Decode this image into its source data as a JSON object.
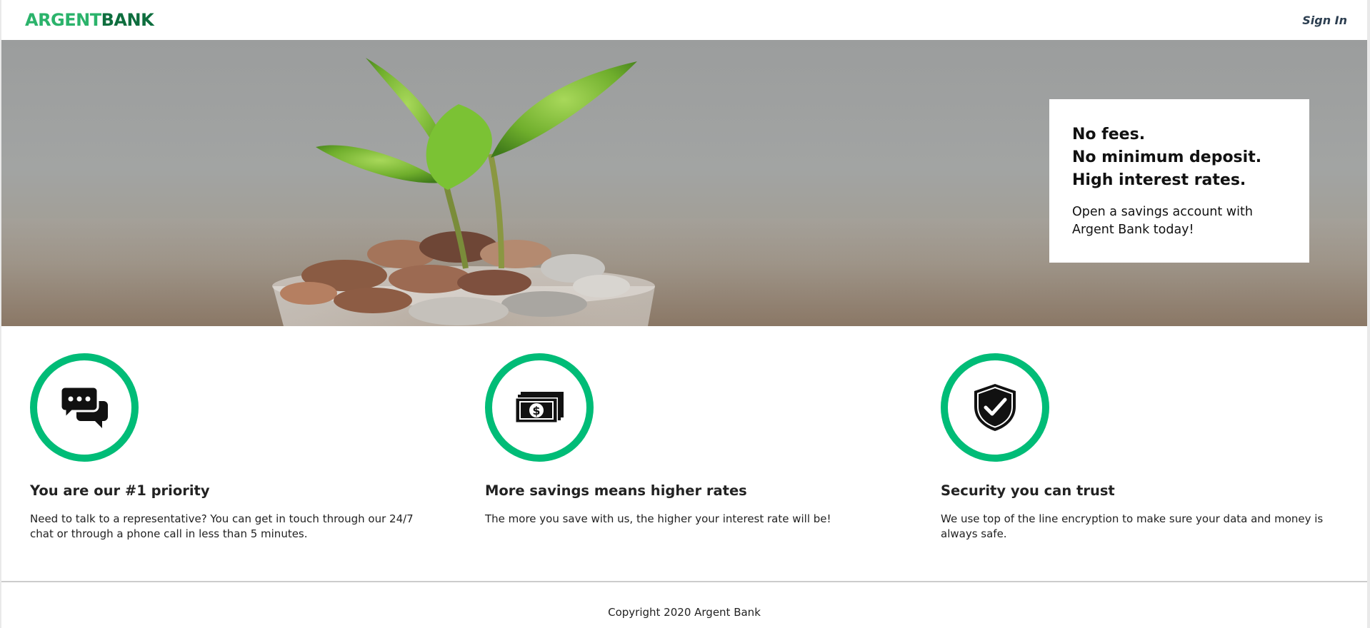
{
  "nav": {
    "logo_part1": "ARGENT",
    "logo_part2": "BANK",
    "sign_in": "Sign In"
  },
  "hero": {
    "subtitles": [
      "No fees.",
      "No minimum deposit.",
      "High interest rates."
    ],
    "text": "Open a savings account with Argent Bank today!"
  },
  "features": [
    {
      "icon": "chat-icon",
      "title": "You are our #1 priority",
      "text": "Need to talk to a representative? You can get in touch through our 24/7 chat or through a phone call in less than 5 minutes."
    },
    {
      "icon": "money-icon",
      "title": "More savings means higher rates",
      "text": "The more you save with us, the higher your interest rate will be!"
    },
    {
      "icon": "security-icon",
      "title": "Security you can trust",
      "text": "We use top of the line encryption to make sure your data and money is always safe."
    }
  ],
  "footer": {
    "copyright": "Copyright 2020 Argent Bank"
  },
  "colors": {
    "accent": "#00bc77",
    "logo_light": "#2bb36b",
    "logo_dark": "#0e6e3e",
    "nav_link": "#2c3e50"
  }
}
